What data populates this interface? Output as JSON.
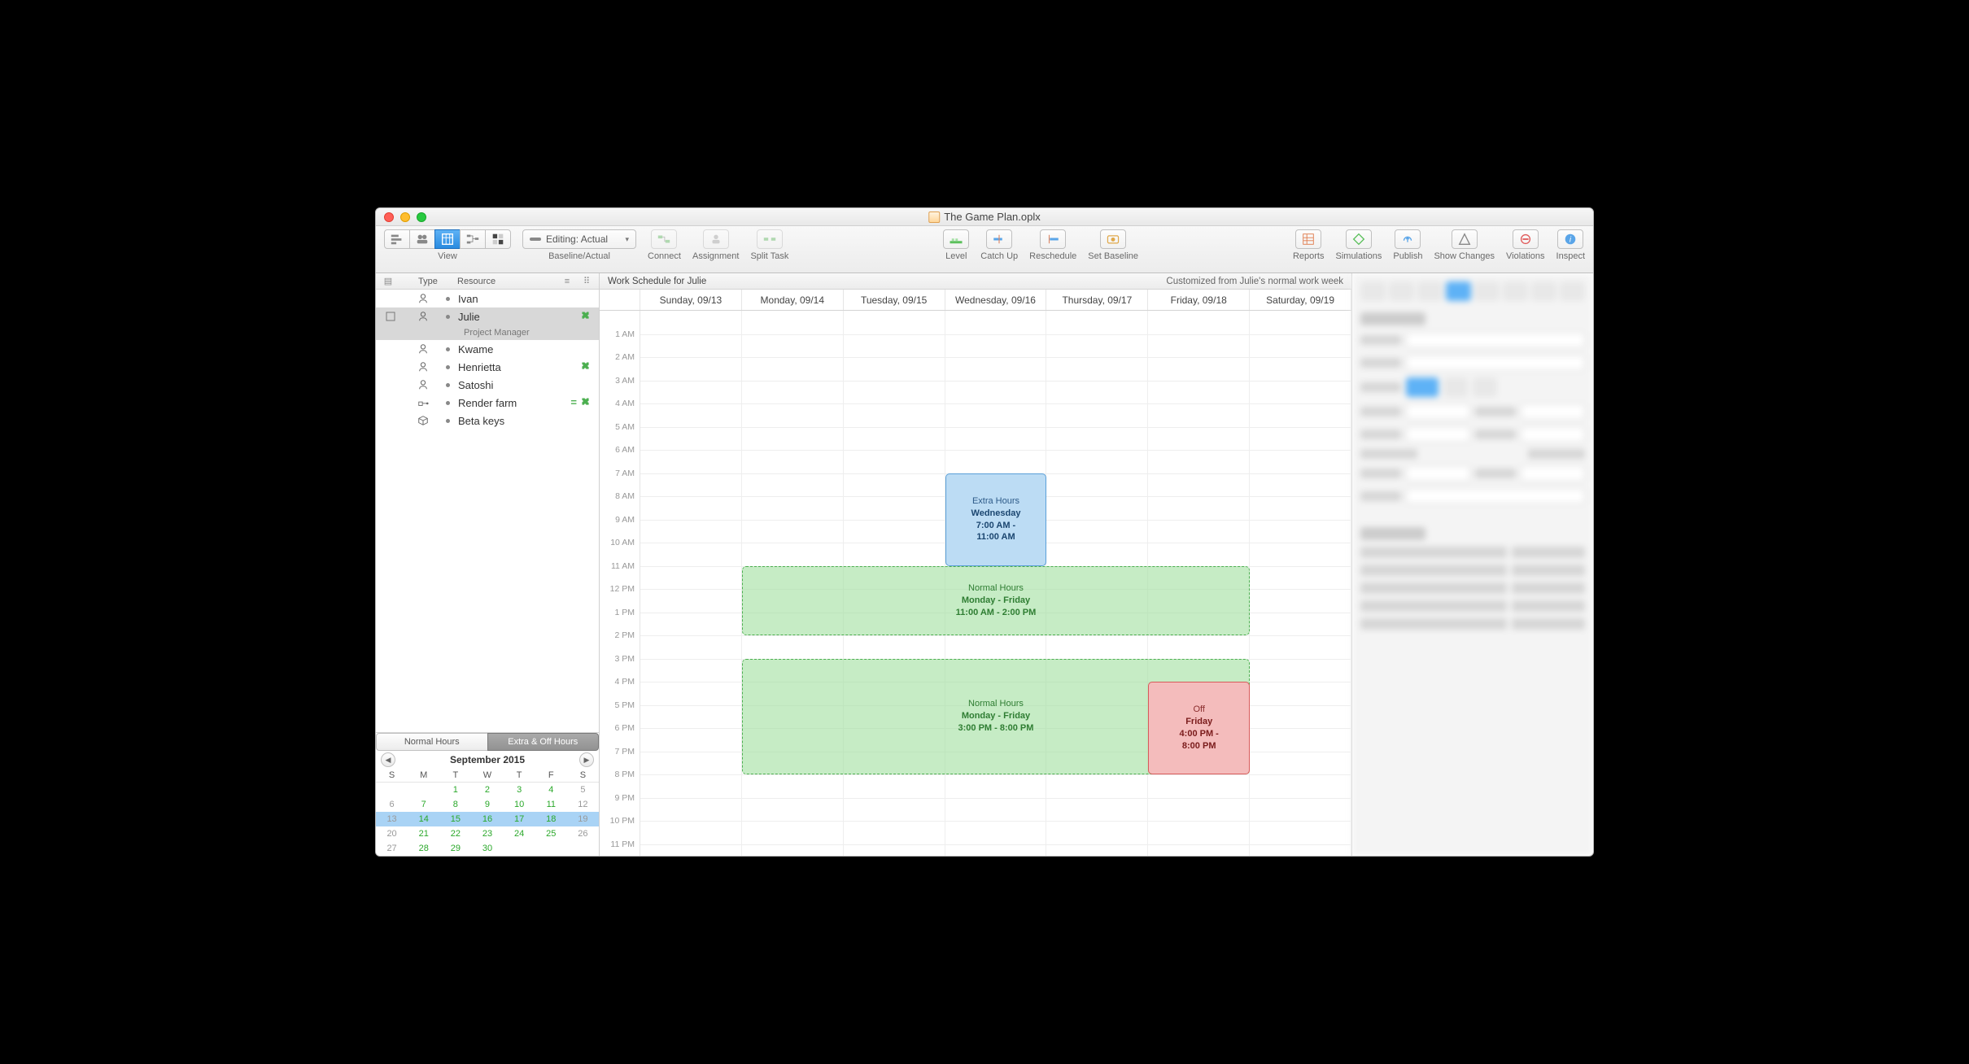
{
  "window_title": "The Game Plan.oplx",
  "toolbar": {
    "view_label": "View",
    "baseline_label": "Baseline/Actual",
    "baseline_value": "Editing: Actual",
    "connect": "Connect",
    "assignment": "Assignment",
    "split_task": "Split Task",
    "level": "Level",
    "catch_up": "Catch Up",
    "reschedule": "Reschedule",
    "set_baseline": "Set Baseline",
    "reports": "Reports",
    "simulations": "Simulations",
    "publish": "Publish",
    "show_changes": "Show Changes",
    "violations": "Violations",
    "inspect": "Inspect"
  },
  "sidebar": {
    "col_type": "Type",
    "col_resource": "Resource",
    "resources": [
      {
        "name": "Ivan",
        "icon": "person"
      },
      {
        "name": "Julie",
        "icon": "person",
        "selected": true,
        "puzzle": true,
        "subtitle": "Project Manager"
      },
      {
        "name": "Kwame",
        "icon": "person"
      },
      {
        "name": "Henrietta",
        "icon": "person",
        "puzzle": true
      },
      {
        "name": "Satoshi",
        "icon": "person"
      },
      {
        "name": "Render farm",
        "icon": "equipment",
        "bars": true,
        "puzzle": true
      },
      {
        "name": "Beta keys",
        "icon": "material"
      }
    ],
    "tabs": {
      "normal": "Normal Hours",
      "extra": "Extra & Off Hours"
    },
    "calendar": {
      "title": "September 2015",
      "dow": [
        "S",
        "M",
        "T",
        "W",
        "T",
        "F",
        "S"
      ],
      "weeks": [
        [
          {
            "n": "",
            "in": false
          },
          {
            "n": "",
            "in": false
          },
          {
            "n": "1",
            "in": true
          },
          {
            "n": "2",
            "in": true
          },
          {
            "n": "3",
            "in": true
          },
          {
            "n": "4",
            "in": true
          },
          {
            "n": "5",
            "in": false,
            "we": true
          }
        ],
        [
          {
            "n": "6",
            "in": false,
            "we": true
          },
          {
            "n": "7",
            "in": true
          },
          {
            "n": "8",
            "in": true
          },
          {
            "n": "9",
            "in": true
          },
          {
            "n": "10",
            "in": true
          },
          {
            "n": "11",
            "in": true
          },
          {
            "n": "12",
            "in": false,
            "we": true
          }
        ],
        [
          {
            "n": "13",
            "in": false,
            "we": true,
            "sel": true
          },
          {
            "n": "14",
            "in": true,
            "sel": true
          },
          {
            "n": "15",
            "in": true,
            "sel": true
          },
          {
            "n": "16",
            "in": true,
            "sel": true
          },
          {
            "n": "17",
            "in": true,
            "sel": true
          },
          {
            "n": "18",
            "in": true,
            "sel": true
          },
          {
            "n": "19",
            "in": false,
            "we": true,
            "sel": true
          }
        ],
        [
          {
            "n": "20",
            "in": false,
            "we": true
          },
          {
            "n": "21",
            "in": true
          },
          {
            "n": "22",
            "in": true
          },
          {
            "n": "23",
            "in": true
          },
          {
            "n": "24",
            "in": true
          },
          {
            "n": "25",
            "in": true
          },
          {
            "n": "26",
            "in": false,
            "we": true
          }
        ],
        [
          {
            "n": "27",
            "in": false,
            "we": true
          },
          {
            "n": "28",
            "in": true
          },
          {
            "n": "29",
            "in": true
          },
          {
            "n": "30",
            "in": true
          },
          {
            "n": "",
            "in": false
          },
          {
            "n": "",
            "in": false
          },
          {
            "n": "",
            "in": false
          }
        ]
      ]
    }
  },
  "schedule": {
    "title": "Work Schedule for Julie",
    "subtitle": "Customized from Julie's normal work week",
    "days": [
      "Sunday, 09/13",
      "Monday, 09/14",
      "Tuesday, 09/15",
      "Wednesday, 09/16",
      "Thursday, 09/17",
      "Friday, 09/18",
      "Saturday, 09/19"
    ],
    "hours": [
      "1 AM",
      "2 AM",
      "3 AM",
      "4 AM",
      "5 AM",
      "6 AM",
      "7 AM",
      "8 AM",
      "9 AM",
      "10 AM",
      "11 AM",
      "12 PM",
      "1 PM",
      "2 PM",
      "3 PM",
      "4 PM",
      "5 PM",
      "6 PM",
      "7 PM",
      "8 PM",
      "9 PM",
      "10 PM",
      "11 PM"
    ],
    "events": {
      "extra": {
        "title": "Extra Hours",
        "line2": "Wednesday",
        "line3": "7:00 AM -",
        "line4": "11:00 AM"
      },
      "normal1": {
        "title": "Normal Hours",
        "line2": "Monday - Friday",
        "line3": "11:00 AM - 2:00 PM"
      },
      "normal2": {
        "title": "Normal Hours",
        "line2": "Monday - Friday",
        "line3": "3:00 PM - 8:00 PM"
      },
      "off": {
        "title": "Off",
        "line2": "Friday",
        "line3": "4:00 PM -",
        "line4": "8:00 PM"
      }
    }
  }
}
